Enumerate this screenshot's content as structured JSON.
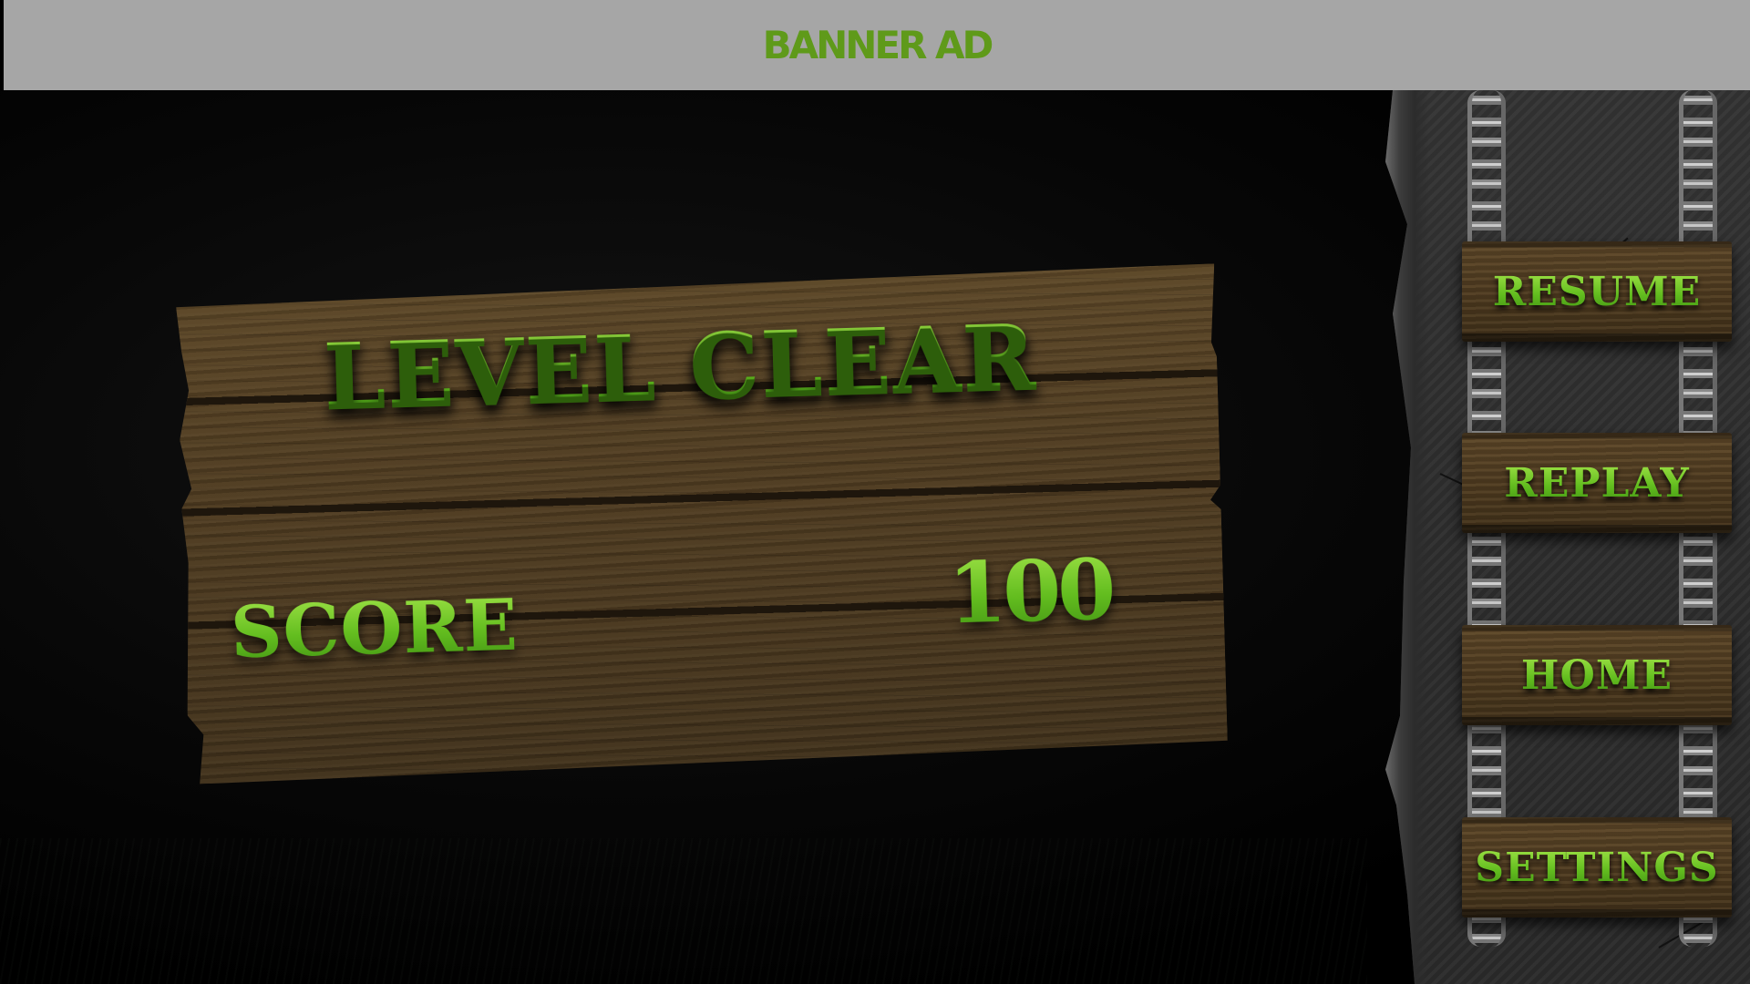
{
  "banner": {
    "text": "BANNER AD"
  },
  "sign": {
    "title": "LEVEL CLEAR",
    "score_label": "SCORE",
    "score_value": "100"
  },
  "menu": {
    "items": [
      {
        "label": "RESUME"
      },
      {
        "label": "REPLAY"
      },
      {
        "label": "HOME"
      },
      {
        "label": "SETTINGS"
      }
    ]
  },
  "colors": {
    "banner_bg": "#a6a6a6",
    "banner_text": "#5f9a1a",
    "text_green": "#6cc626",
    "wood": "#4d3a20",
    "stone": "#2d2d2d"
  }
}
